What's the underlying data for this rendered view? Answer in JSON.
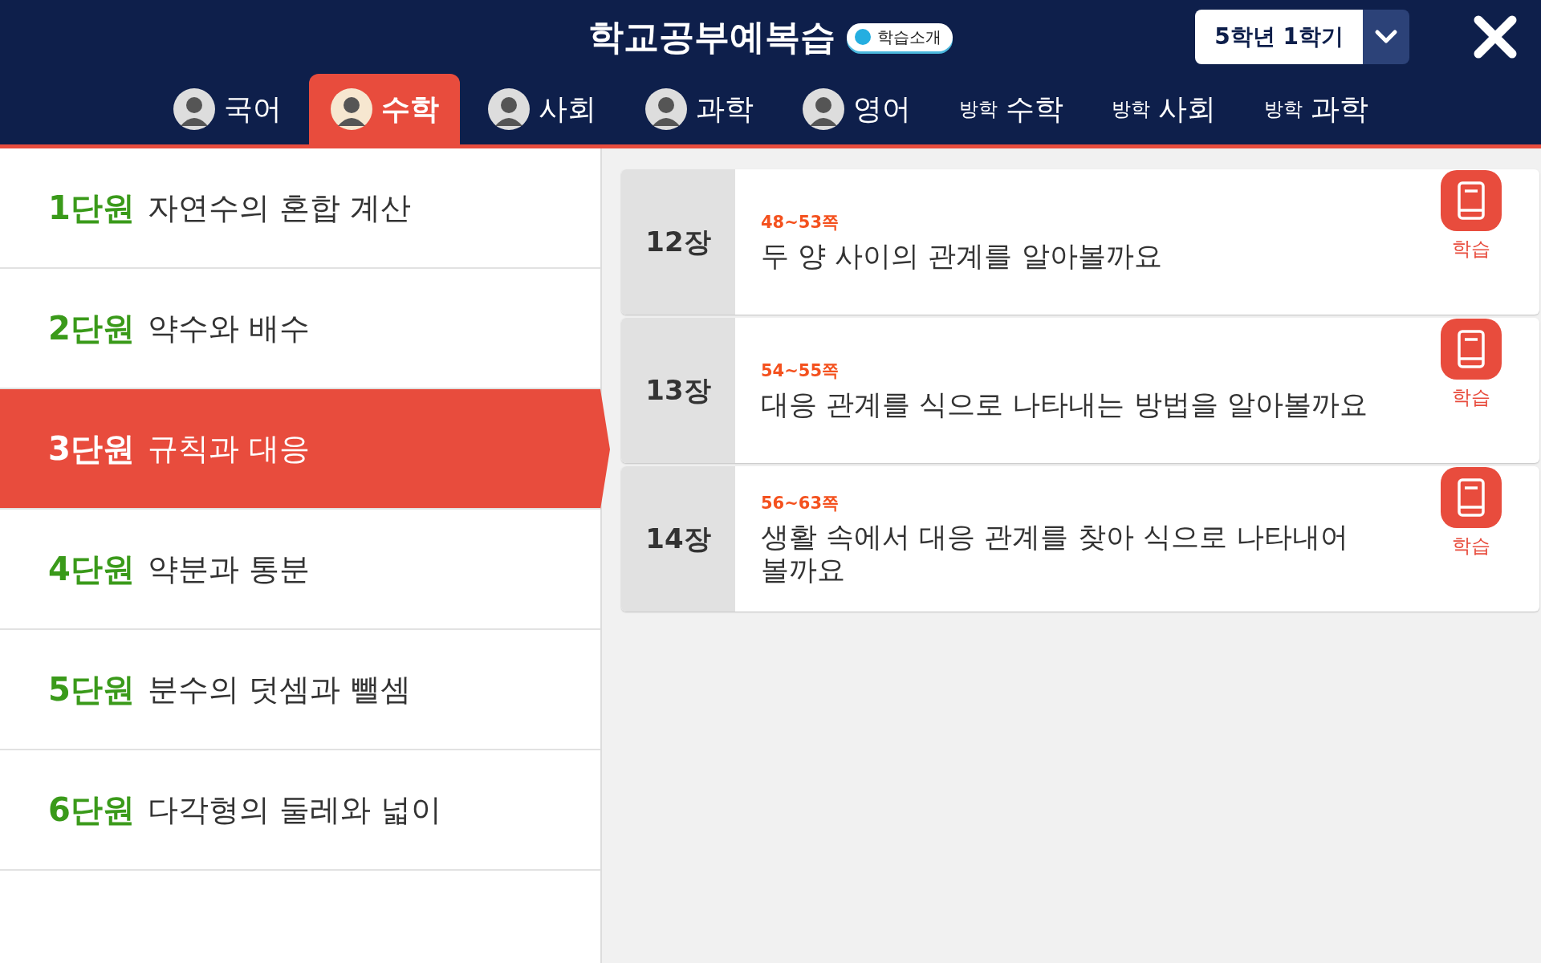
{
  "header": {
    "title": "학교공부예복습",
    "intro_button": "학습소개",
    "grade_select": "5학년 1학기"
  },
  "tabs": [
    {
      "kind": "avatar",
      "label": "국어",
      "selected": false
    },
    {
      "kind": "avatar",
      "label": "수학",
      "selected": true
    },
    {
      "kind": "avatar",
      "label": "사회",
      "selected": false
    },
    {
      "kind": "avatar",
      "label": "과학",
      "selected": false
    },
    {
      "kind": "avatar",
      "label": "영어",
      "selected": false
    },
    {
      "kind": "vacation",
      "prefix": "방학",
      "label": "수학",
      "selected": false
    },
    {
      "kind": "vacation",
      "prefix": "방학",
      "label": "사회",
      "selected": false
    },
    {
      "kind": "vacation",
      "prefix": "방학",
      "label": "과학",
      "selected": false
    }
  ],
  "units": [
    {
      "number": "1단원",
      "title": "자연수의 혼합 계산",
      "selected": false
    },
    {
      "number": "2단원",
      "title": "약수와 배수",
      "selected": false
    },
    {
      "number": "3단원",
      "title": "규칙과 대응",
      "selected": true
    },
    {
      "number": "4단원",
      "title": "약분과 통분",
      "selected": false
    },
    {
      "number": "5단원",
      "title": "분수의 덧셈과 뺄셈",
      "selected": false
    },
    {
      "number": "6단원",
      "title": "다각형의 둘레와 넓이",
      "selected": false
    }
  ],
  "chapters": [
    {
      "chapter": "12장",
      "pages": "48~53쪽",
      "title": "두 양 사이의 관계를 알아볼까요",
      "action": "학습"
    },
    {
      "chapter": "13장",
      "pages": "54~55쪽",
      "title": "대응 관계를 식으로 나타내는 방법을 알아볼까요",
      "action": "학습"
    },
    {
      "chapter": "14장",
      "pages": "56~63쪽",
      "title": "생활 속에서 대응 관계를 찾아 식으로 나타내어 볼까요",
      "action": "학습"
    }
  ]
}
